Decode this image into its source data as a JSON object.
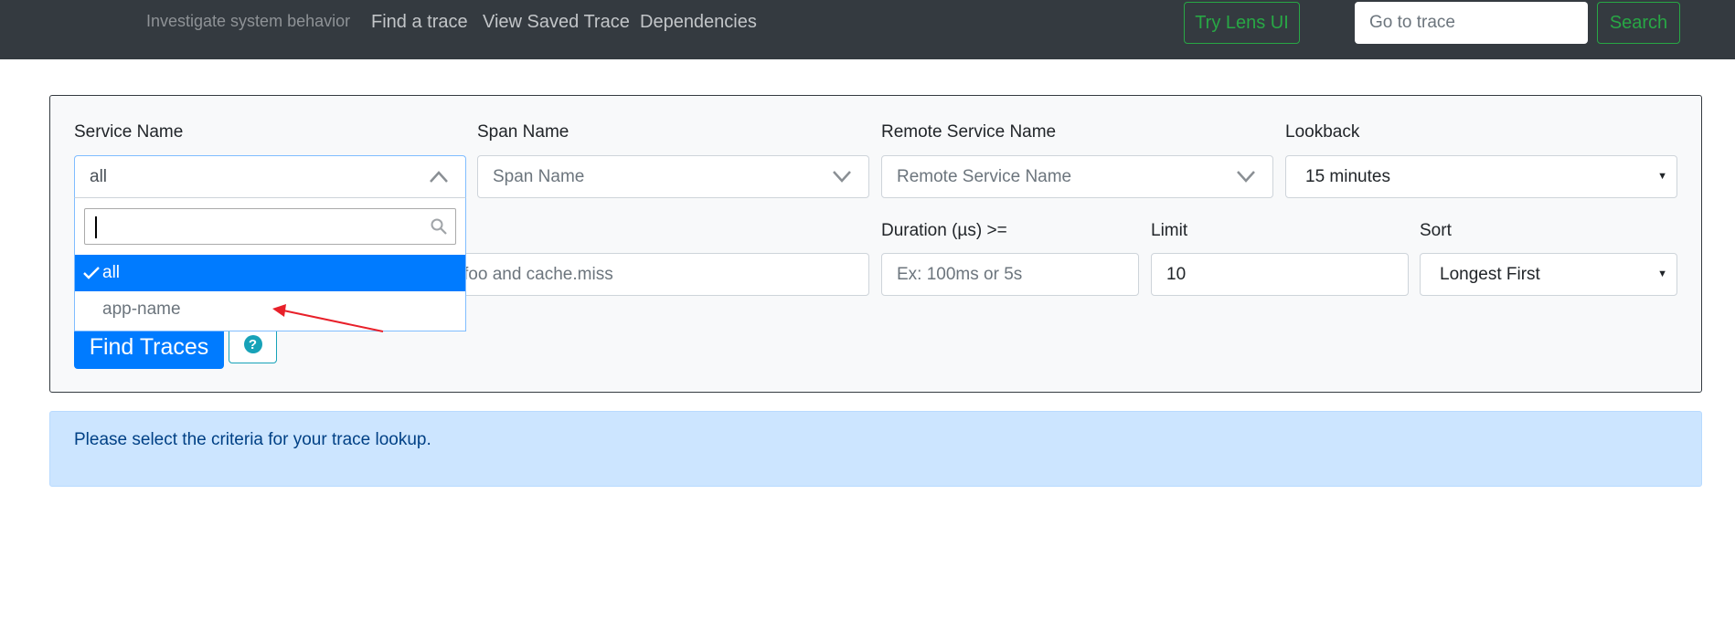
{
  "navbar": {
    "tagline": "Investigate system behavior",
    "links": [
      "Find a trace",
      "View Saved Trace",
      "Dependencies"
    ],
    "try_lens_label": "Try Lens UI",
    "goto_placeholder": "Go to trace",
    "search_label": "Search"
  },
  "search_form": {
    "service_name": {
      "label": "Service Name",
      "value": "all"
    },
    "span_name": {
      "label": "Span Name",
      "placeholder": "Span Name"
    },
    "remote_service_name": {
      "label": "Remote Service Name",
      "placeholder": "Remote Service Name"
    },
    "lookback": {
      "label": "Lookback",
      "value": "15 minutes"
    },
    "annotations_query": {
      "placeholder_visible": "foo and cache.miss"
    },
    "duration": {
      "label": "Duration (µs) >=",
      "placeholder": "Ex: 100ms or 5s"
    },
    "limit": {
      "label": "Limit",
      "value": "10"
    },
    "sort": {
      "label": "Sort",
      "value": "Longest First"
    },
    "find_button": "Find Traces",
    "help_icon": "?"
  },
  "service_dropdown": {
    "search_value": "",
    "options": [
      {
        "label": "all",
        "selected": true
      },
      {
        "label": "app-name",
        "selected": false
      }
    ]
  },
  "alert": {
    "text": "Please select the criteria for your trace lookup."
  },
  "colors": {
    "navbar": "#343a40",
    "primary": "#007bff",
    "success": "#28a745",
    "info": "#17a2b8",
    "alert_bg": "#cce5ff",
    "annotation_arrow": "#e8202a"
  }
}
